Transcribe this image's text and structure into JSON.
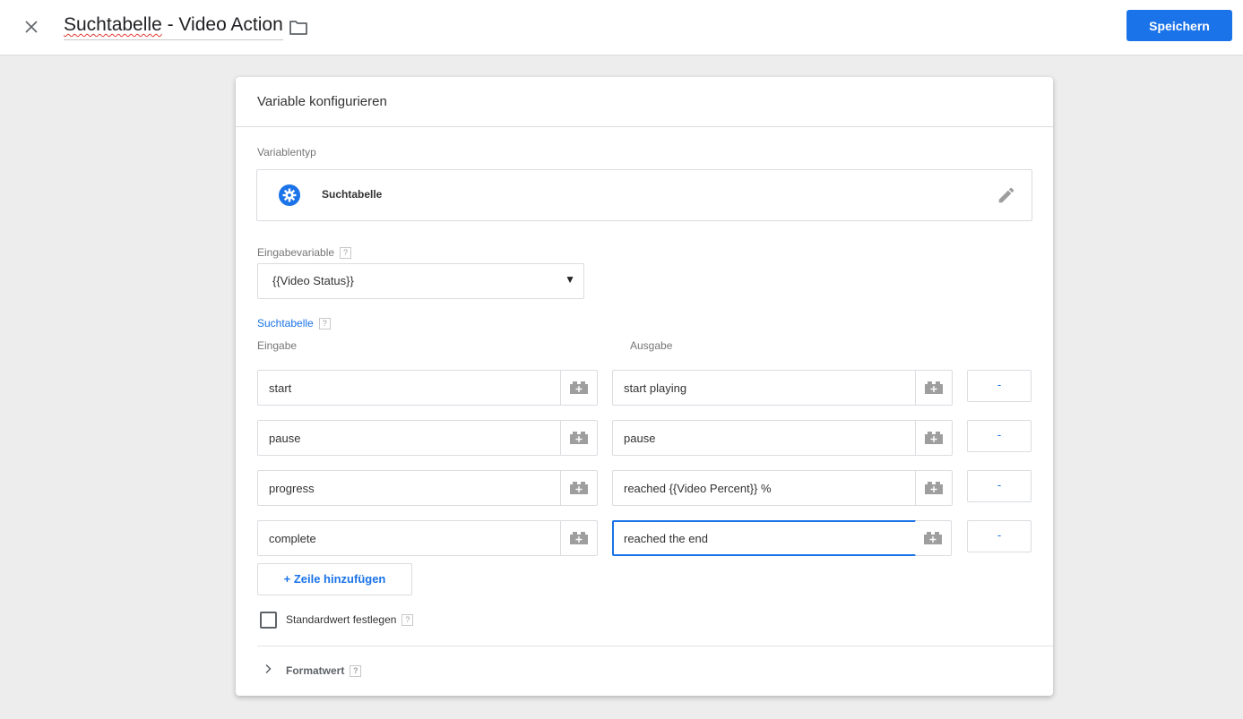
{
  "header": {
    "title_part1": "Suchtabelle",
    "title_part2": " - Video Action",
    "save_label": "Speichern"
  },
  "card": {
    "title": "Variable konfigurieren",
    "variable_type_label": "Variablentyp",
    "variable_type_name": "Suchtabelle",
    "input_variable_label": "Eingabevariable",
    "input_variable_value": "{{Video Status}}",
    "lookup_table_label": "Suchtabelle",
    "input_col_label": "Eingabe",
    "output_col_label": "Ausgabe",
    "rows": [
      {
        "input": "start",
        "output": "start playing",
        "remove": "-"
      },
      {
        "input": "pause",
        "output": "pause",
        "remove": "-"
      },
      {
        "input": "progress",
        "output": "reached {{Video Percent}} %",
        "remove": "-"
      },
      {
        "input": "complete",
        "output": "reached the end",
        "remove": "-"
      }
    ],
    "add_row_label": "+ Zeile hinzufügen",
    "default_value_label": "Standardwert festlegen",
    "format_value_label": "Formatwert",
    "help_glyph": "?"
  },
  "colors": {
    "accent": "#1a73e8",
    "background": "#ededed",
    "border": "#dadce0"
  },
  "icons": [
    "close-icon",
    "folder-icon",
    "gear-icon",
    "pencil-icon",
    "variable-block-icon",
    "chevron-right-icon",
    "dropdown-arrow-icon"
  ]
}
